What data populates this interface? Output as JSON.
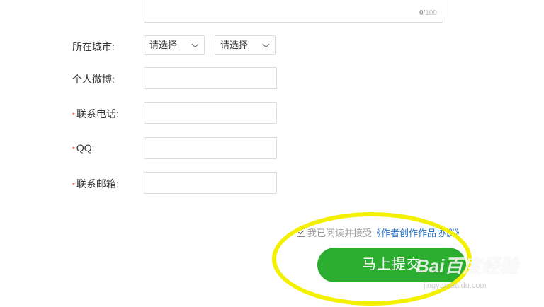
{
  "textarea": {
    "count_current": "0",
    "count_max": "/100"
  },
  "city": {
    "label": "所在城市:",
    "select1": "请选择",
    "select2": "请选择"
  },
  "weibo": {
    "label": "个人微博:"
  },
  "phone": {
    "required_mark": "*",
    "label": "联系电话:"
  },
  "qq": {
    "required_mark": "*",
    "label": "QQ:"
  },
  "email": {
    "required_mark": "*",
    "label": "联系邮箱:"
  },
  "agreement": {
    "prefix": "我已阅读并接受",
    "link": "《作者创作作品协议》"
  },
  "submit_label": "马上提交",
  "watermark": {
    "logo": "Bai百度经验",
    "url": "jingyan.baidu.com"
  }
}
